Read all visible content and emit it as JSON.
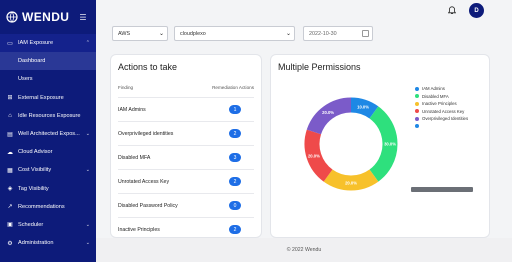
{
  "brand": {
    "name": "WENDU"
  },
  "sidebar": {
    "items": [
      {
        "label": "IAM Exposure",
        "icon": "monitor-icon",
        "chevron": "⌃",
        "active_parent": true
      },
      {
        "label": "Dashboard",
        "sub": true,
        "active": true
      },
      {
        "label": "Users",
        "sub": true
      },
      {
        "label": "External Exposure",
        "icon": "external-icon"
      },
      {
        "label": "Idle Resources Exposure",
        "icon": "idle-icon"
      },
      {
        "label": "Well Architected Expos...",
        "icon": "architect-icon",
        "chevron": "⌄"
      },
      {
        "label": "Cloud Advisor",
        "icon": "cloud-icon"
      },
      {
        "label": "Cost Visibility",
        "icon": "cost-icon",
        "chevron": "⌄"
      },
      {
        "label": "Tag Visibility",
        "icon": "tag-icon"
      },
      {
        "label": "Recommendations",
        "icon": "trend-icon"
      },
      {
        "label": "Scheduler",
        "icon": "calendar-icon",
        "chevron": "⌄"
      },
      {
        "label": "Administration",
        "icon": "admin-icon",
        "chevron": "⌄"
      }
    ]
  },
  "topbar": {
    "avatar_initial": "D"
  },
  "filters": {
    "provider": "AWS",
    "account": "cloudplexo",
    "date": "2022-10-30"
  },
  "actions": {
    "title": "Actions to take",
    "col_finding": "Finding",
    "col_actions": "Remediation Actions",
    "rows": [
      {
        "label": "IAM Admins",
        "value": "1"
      },
      {
        "label": "Overprivileged identities",
        "value": "2"
      },
      {
        "label": "Disabled MFA",
        "value": "3"
      },
      {
        "label": "Unrotated Access Key",
        "value": "2"
      },
      {
        "label": "Disabled Password Policy",
        "value": "0"
      },
      {
        "label": "Inactive Principles",
        "value": "2"
      }
    ]
  },
  "permissions": {
    "title": "Multiple Permissions",
    "chart_data": {
      "type": "pie",
      "categories": [
        "IAM Admins",
        "Disabled MFA",
        "Inactive Principles",
        "Unrotated Access Key",
        "Overprivileged Identities"
      ],
      "values": [
        10.0,
        30.0,
        20.0,
        20.0,
        20.0
      ],
      "labels": [
        "10.0%",
        "30.0%",
        "20.0%",
        "20.0%",
        "20.0%"
      ],
      "colors": [
        "#1e88e5",
        "#2ee07d",
        "#f7c12b",
        "#ef4a4a",
        "#7b5bc9"
      ]
    },
    "legend": [
      {
        "label": "IAM Admins",
        "color": "#1e88e5"
      },
      {
        "label": "Disabled MFA",
        "color": "#2ee07d"
      },
      {
        "label": "Inactive Principles",
        "color": "#f7c12b"
      },
      {
        "label": "Unrotated Access Key",
        "color": "#ef4a4a"
      },
      {
        "label": "Overprivileged Identities",
        "color": "#7b5bc9"
      },
      {
        "label": "",
        "color": "#1e88e5"
      }
    ]
  },
  "footer": {
    "text": "© 2022 Wendu"
  }
}
